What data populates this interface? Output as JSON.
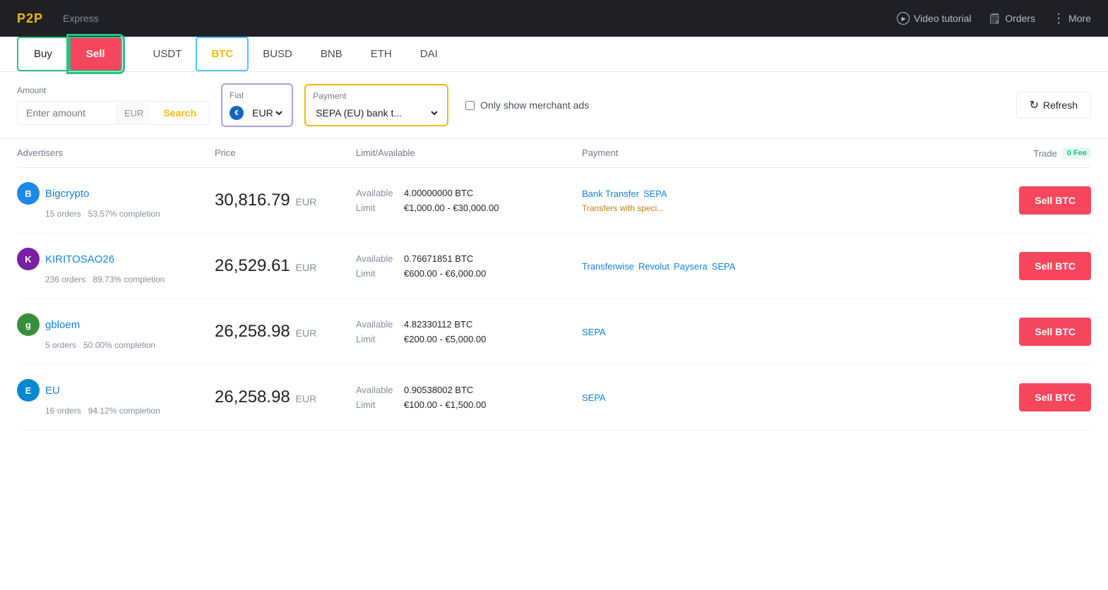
{
  "topnav": {
    "brand": "P2P",
    "express": "Express",
    "video_tutorial": "Video tutorial",
    "orders": "Orders",
    "more": "More"
  },
  "tabs": {
    "buy": "Buy",
    "sell": "Sell",
    "coins": [
      "USDT",
      "BTC",
      "BUSD",
      "BNB",
      "ETH",
      "DAI"
    ]
  },
  "filters": {
    "amount_label": "Amount",
    "amount_placeholder": "Enter amount",
    "amount_currency": "EUR",
    "search": "Search",
    "fiat_label": "Fiat",
    "fiat_value": "EUR",
    "payment_label": "Payment",
    "payment_value": "SEPA (EU) bank t...",
    "merchant_label": "Only show merchant ads",
    "refresh": "Refresh"
  },
  "table": {
    "headers": {
      "advertisers": "Advertisers",
      "price": "Price",
      "limit_available": "Limit/Available",
      "payment": "Payment",
      "trade": "Trade",
      "fee": "0 Fee"
    },
    "rows": [
      {
        "id": "bigcrypto",
        "avatar_letter": "B",
        "avatar_color": "#1e88e5",
        "name": "Bigcrypto",
        "orders": "15 orders",
        "completion": "53.57% completion",
        "price": "30,816.79",
        "currency": "EUR",
        "available_label": "Available",
        "available_value": "4.00000000 BTC",
        "limit_label": "Limit",
        "limit_value": "€1,000.00 - €30,000.00",
        "payment_tags": [
          "Bank Transfer",
          "SEPA"
        ],
        "payment_note": "Transfers with speci...",
        "trade_btn": "Sell BTC"
      },
      {
        "id": "kiritosao26",
        "avatar_letter": "K",
        "avatar_color": "#7b1fa2",
        "name": "KIRITOSAO26",
        "orders": "236 orders",
        "completion": "89.73% completion",
        "price": "26,529.61",
        "currency": "EUR",
        "available_label": "Available",
        "available_value": "0.76671851 BTC",
        "limit_label": "Limit",
        "limit_value": "€600.00 - €6,000.00",
        "payment_tags": [
          "Transferwise",
          "Revolut",
          "Paysera",
          "SEPA"
        ],
        "payment_note": "",
        "trade_btn": "Sell BTC"
      },
      {
        "id": "gbloem",
        "avatar_letter": "g",
        "avatar_color": "#388e3c",
        "name": "gbloem",
        "orders": "5 orders",
        "completion": "50.00% completion",
        "price": "26,258.98",
        "currency": "EUR",
        "available_label": "Available",
        "available_value": "4.82330112 BTC",
        "limit_label": "Limit",
        "limit_value": "€200.00 - €5,000.00",
        "payment_tags": [
          "SEPA"
        ],
        "payment_note": "",
        "trade_btn": "Sell BTC"
      },
      {
        "id": "eu",
        "avatar_letter": "E",
        "avatar_color": "#0288d1",
        "name": "EU",
        "orders": "16 orders",
        "completion": "94.12% completion",
        "price": "26,258.98",
        "currency": "EUR",
        "available_label": "Available",
        "available_value": "0.90538002 BTC",
        "limit_label": "Limit",
        "limit_value": "€100.00 - €1,500.00",
        "payment_tags": [
          "SEPA"
        ],
        "payment_note": "",
        "trade_btn": "Sell BTC"
      }
    ]
  }
}
